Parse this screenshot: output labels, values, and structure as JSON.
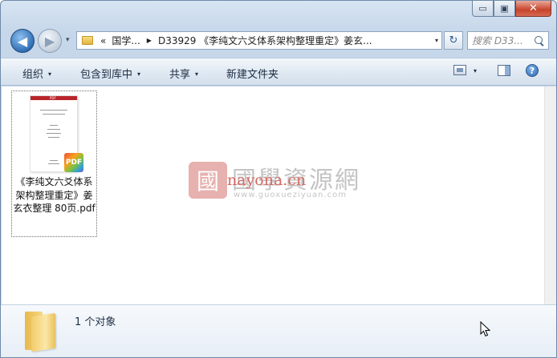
{
  "window": {
    "caption_minimize": "▭",
    "caption_maximize": "▣",
    "caption_close": "✕"
  },
  "nav": {
    "back_glyph": "◀",
    "forward_glyph": "▶",
    "recent_glyph": "▾"
  },
  "address": {
    "chevron": "«",
    "segments": [
      "国学...",
      "D33929 《李纯文六爻体系架构整理重定》姜玄..."
    ],
    "separator": "▶",
    "dropdown": "▾",
    "refresh_glyph": "↻"
  },
  "search": {
    "placeholder": "搜索 D33..."
  },
  "toolbar": {
    "organize": "组织",
    "include_in_library": "包含到库中",
    "share": "共享",
    "new_folder": "新建文件夹",
    "dropdown_glyph": "▾",
    "help_glyph": "?"
  },
  "files": [
    {
      "name": "《李纯文六爻体系架构整理重定》姜玄衣整理 80页.pdf",
      "badge": "PDF",
      "thumb_header": "PDF"
    }
  ],
  "watermark": {
    "seal": "國",
    "chinese": "國學資源網",
    "latin": "nayona.cn",
    "url": "www.guoxueziyuan.com"
  },
  "details": {
    "summary": "1 个对象"
  }
}
